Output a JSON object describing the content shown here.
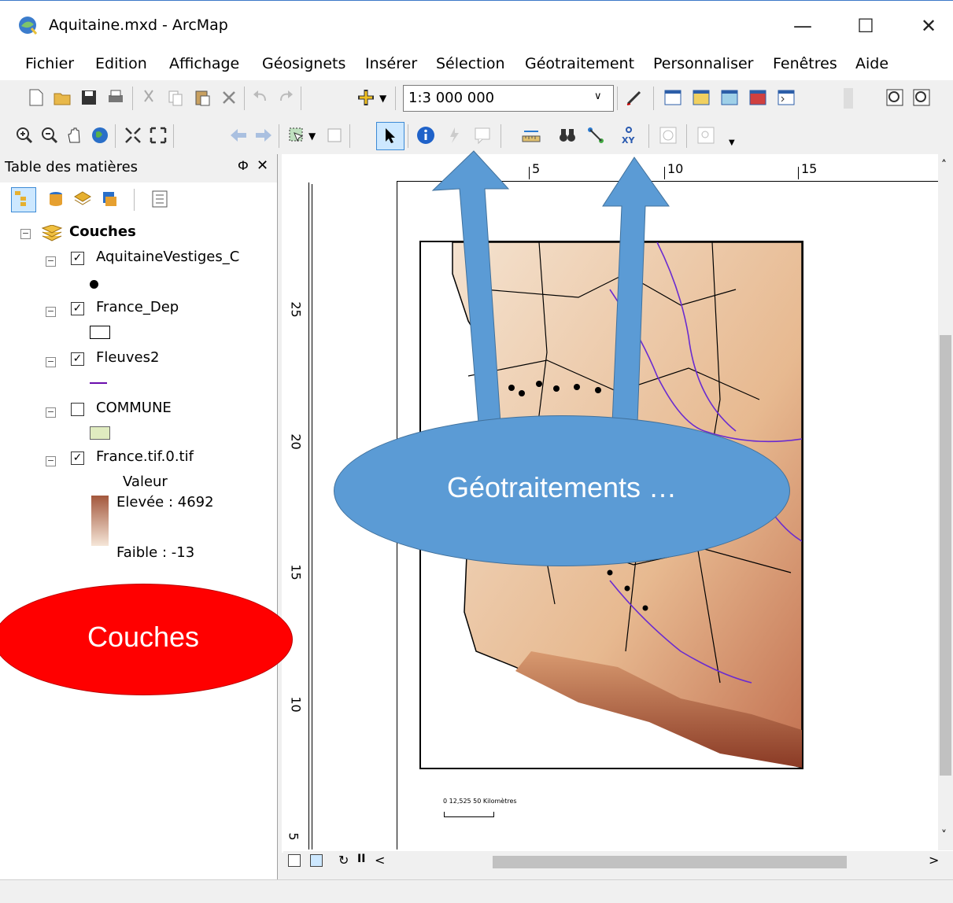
{
  "window": {
    "title": "Aquitaine.mxd - ArcMap"
  },
  "menu": [
    {
      "label": "Fichier"
    },
    {
      "label": "Edition"
    },
    {
      "label": "Affichage"
    },
    {
      "label": "Géosignets"
    },
    {
      "label": "Insérer"
    },
    {
      "label": "Sélection"
    },
    {
      "label": "Géotraitement"
    },
    {
      "label": "Personnaliser"
    },
    {
      "label": "Fenêtres"
    },
    {
      "label": "Aide"
    }
  ],
  "toolbar": {
    "scale": "1:3 000 000"
  },
  "toc": {
    "title": "Table des matières",
    "root": "Couches",
    "layers": [
      {
        "name": "AquitaineVestiges_C",
        "checked": true
      },
      {
        "name": "France_Dep",
        "checked": true
      },
      {
        "name": "Fleuves2",
        "checked": true
      },
      {
        "name": "COMMUNE",
        "checked": false
      },
      {
        "name": "France.tif.0.tif",
        "checked": true
      }
    ],
    "raster_legend": {
      "title": "Valeur",
      "high": "Elevée : 4692",
      "low": "Faible : -13"
    }
  },
  "rulers": {
    "h": [
      "5",
      "10",
      "15"
    ],
    "v": [
      "25",
      "20",
      "15",
      "10",
      "5"
    ]
  },
  "scalebar": {
    "text": "0 12,525    50 Kilomètres"
  },
  "annotations": {
    "geotraitements": "Géotraitements …",
    "couches": "Couches"
  },
  "colors": {
    "callout_blue": "#5b9bd5",
    "callout_red": "#ff0000",
    "window_border": "#3c78c8"
  }
}
